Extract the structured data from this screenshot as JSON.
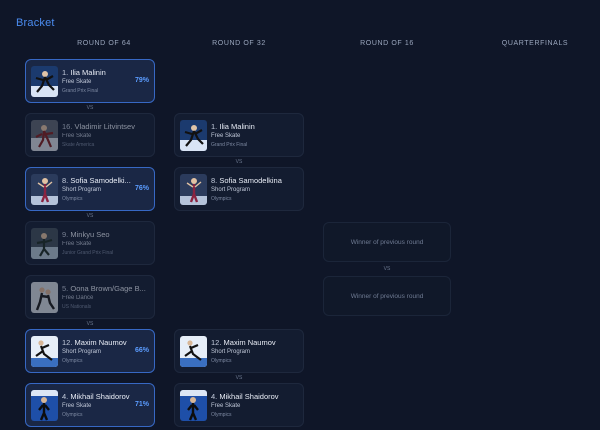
{
  "title": "Bracket",
  "columns": [
    "ROUND OF 64",
    "ROUND OF 32",
    "ROUND OF 16",
    "QUARTERFINALS"
  ],
  "vs_label": "VS",
  "round64": [
    {
      "seed": "1.",
      "name": "Ilia Malinin",
      "event": "Free Skate",
      "competition": "Grand Prix Final",
      "score": "79%",
      "winner": true
    },
    {
      "seed": "16.",
      "name": "Vladimir Litvintsev",
      "event": "Free Skate",
      "competition": "Skate America",
      "score": "",
      "winner": false
    },
    {
      "seed": "8.",
      "name": "Sofia Samodelki...",
      "event": "Short Program",
      "competition": "Olympics",
      "score": "76%",
      "winner": true
    },
    {
      "seed": "9.",
      "name": "Minkyu Seo",
      "event": "Free Skate",
      "competition": "Junior Grand Prix Final",
      "score": "",
      "winner": false
    },
    {
      "seed": "5.",
      "name": "Oona Brown/Gage B...",
      "event": "Free Dance",
      "competition": "US Nationals",
      "score": "",
      "winner": false
    },
    {
      "seed": "12.",
      "name": "Maxim Naumov",
      "event": "Short Program",
      "competition": "Olympics",
      "score": "66%",
      "winner": true
    },
    {
      "seed": "4.",
      "name": "Mikhail Shaidorov",
      "event": "Free Skate",
      "competition": "Olympics",
      "score": "71%",
      "winner": true
    }
  ],
  "round32": [
    {
      "seed": "1.",
      "name": "Ilia Malinin",
      "event": "Free Skate",
      "competition": "Grand Prix Final"
    },
    {
      "seed": "8.",
      "name": "Sofia Samodelkina",
      "event": "Short Program",
      "competition": "Olympics"
    },
    {
      "seed": "12.",
      "name": "Maxim Naumov",
      "event": "Short Program",
      "competition": "Olympics"
    },
    {
      "seed": "4.",
      "name": "Mikhail Shaidorov",
      "event": "Free Skate",
      "competition": "Olympics"
    }
  ],
  "round16": {
    "placeholder_1": "Winner of previous round",
    "placeholder_2": "Winner of previous round"
  }
}
